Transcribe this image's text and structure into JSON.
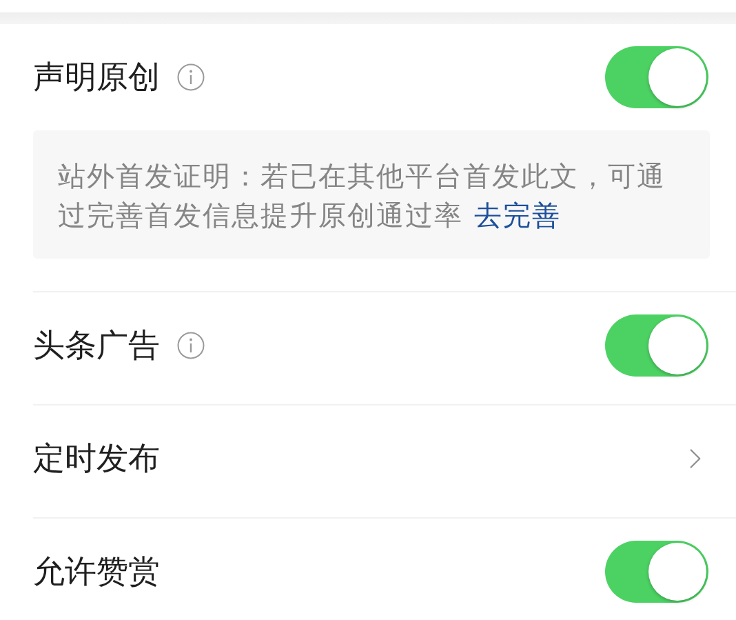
{
  "settings": [
    {
      "kind": "toggle",
      "label": "声明原创",
      "info": true,
      "on": true,
      "note": {
        "text": "站外首发证明：若已在其他平台首发此文，可通过完善首发信息提升原创通过率",
        "link": "去完善"
      }
    },
    {
      "kind": "toggle",
      "label": "头条广告",
      "info": true,
      "on": true
    },
    {
      "kind": "link",
      "label": "定时发布"
    },
    {
      "kind": "toggle",
      "label": "允许赞赏",
      "on": true
    }
  ]
}
